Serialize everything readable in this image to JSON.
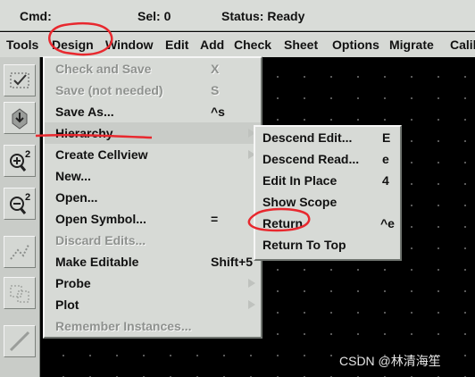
{
  "status": {
    "cmd_label": "Cmd:",
    "sel_label": "Sel: 0",
    "status_label": "Status: Ready"
  },
  "menubar": {
    "items": [
      "Tools",
      "Design",
      "Window",
      "Edit",
      "Add",
      "Check",
      "Sheet",
      "Options",
      "Migrate",
      "Calib"
    ]
  },
  "toolbar": {
    "tools": [
      "check-and-save-icon",
      "save-icon",
      "zoom-in-2-icon",
      "zoom-out-2-icon",
      "stretch-icon",
      "copy-icon",
      "wire-icon"
    ]
  },
  "design_menu": {
    "items": [
      {
        "label": "Check and Save",
        "accel": "X",
        "disabled": true
      },
      {
        "label": "Save (not needed)",
        "accel": "S",
        "disabled": true
      },
      {
        "label": "Save As...",
        "accel": "^s",
        "disabled": false
      },
      {
        "label": "Hierarchy",
        "accel": "",
        "disabled": false,
        "submenu": true
      },
      {
        "label": "Create Cellview",
        "accel": "",
        "disabled": false,
        "submenu": true
      },
      {
        "label": "New...",
        "accel": "",
        "disabled": false
      },
      {
        "label": "Open...",
        "accel": "",
        "disabled": false
      },
      {
        "label": "Open Symbol...",
        "accel": "=",
        "disabled": false
      },
      {
        "label": "Discard Edits...",
        "accel": "",
        "disabled": true
      },
      {
        "label": "Make Editable",
        "accel": "Shift+5",
        "disabled": false
      },
      {
        "label": "Probe",
        "accel": "",
        "disabled": false,
        "submenu": true
      },
      {
        "label": "Plot",
        "accel": "",
        "disabled": false,
        "submenu": true
      },
      {
        "label": "Remember Instances...",
        "accel": "",
        "disabled": true
      }
    ]
  },
  "hierarchy_menu": {
    "items": [
      {
        "label": "Descend Edit...",
        "accel": "E"
      },
      {
        "label": "Descend Read...",
        "accel": "e"
      },
      {
        "label": "Edit In Place",
        "accel": "4"
      },
      {
        "label": "Show Scope",
        "accel": ""
      },
      {
        "label": "Return",
        "accel": "^e"
      },
      {
        "label": "Return To Top",
        "accel": ""
      }
    ]
  },
  "watermark": "CSDN @林清海笙",
  "colors": {
    "annotation_red": "#e8282e",
    "menu_bg": "#d7dad6",
    "canvas_bg": "#000000"
  }
}
